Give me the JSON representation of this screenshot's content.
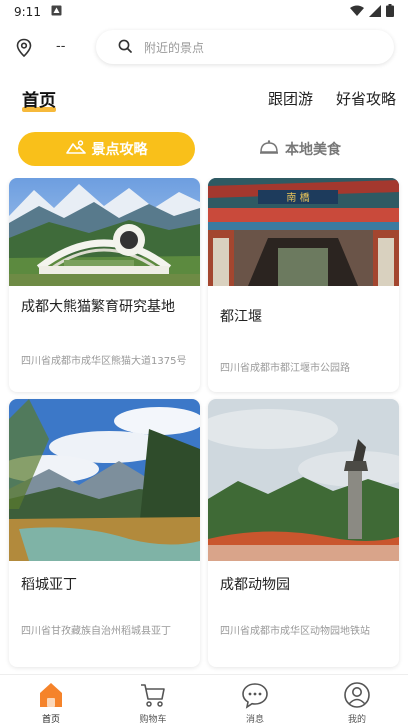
{
  "status": {
    "time": "9:11"
  },
  "header": {
    "location": "--",
    "search_placeholder": "附近的景点"
  },
  "nav": {
    "home": "首页",
    "group_tour": "跟团游",
    "budget_guide": "好省攻略"
  },
  "tabs": {
    "attractions": "景点攻略",
    "local_food": "本地美食"
  },
  "cards": [
    {
      "title": "成都大熊猫繁育研究基地",
      "address": "四川省成都市成华区熊猫大道1375号"
    },
    {
      "title": "都江堰",
      "address": "四川省成都市都江堰市公园路"
    },
    {
      "title": "稻城亚丁",
      "address": "四川省甘孜藏族自治州稻城县亚丁"
    },
    {
      "title": "成都动物园",
      "address": "四川省成都市成华区动物园地铁站"
    }
  ],
  "bottom_tabs": {
    "home": "首页",
    "cart": "购物车",
    "messages": "消息",
    "mine": "我的"
  },
  "colors": {
    "accent": "#f9c01a",
    "home_tab": "#f5832a"
  }
}
